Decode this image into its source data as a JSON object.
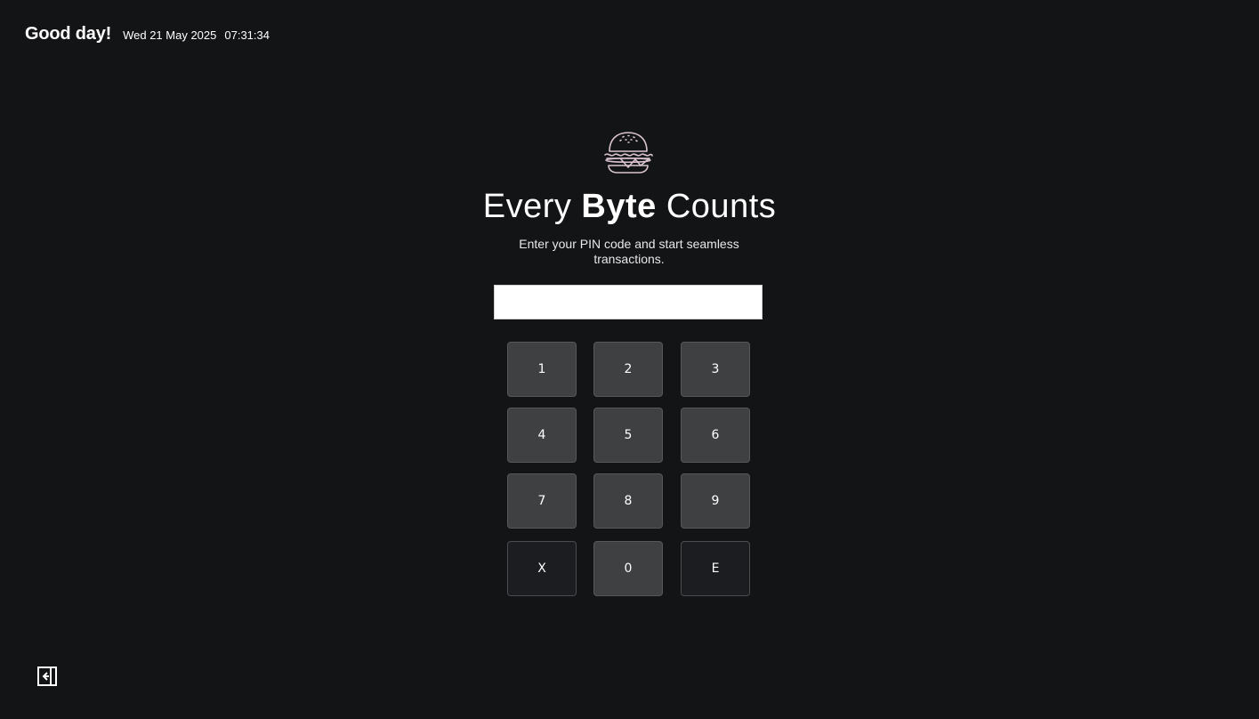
{
  "header": {
    "greeting": "Good day!",
    "date": "Wed 21 May 2025",
    "time": "07:31:34"
  },
  "brand": {
    "word1": "Every",
    "word2": "Byte",
    "word3": "Counts",
    "logo_icon": "burger-icon"
  },
  "subtitle": "Enter your PIN code and start seamless transactions.",
  "pin": {
    "value": "",
    "placeholder": ""
  },
  "keypad": {
    "k1": "1",
    "k2": "2",
    "k3": "3",
    "k4": "4",
    "k5": "5",
    "k6": "6",
    "k7": "7",
    "k8": "8",
    "k9": "9",
    "clear": "X",
    "k0": "0",
    "enter": "E"
  },
  "footer": {
    "logout_icon": "logout-icon"
  },
  "colors": {
    "background": "#131416",
    "key": "#3f4042",
    "key_dark": "#1c1d20",
    "logo_stroke": "#d9c3cf"
  }
}
